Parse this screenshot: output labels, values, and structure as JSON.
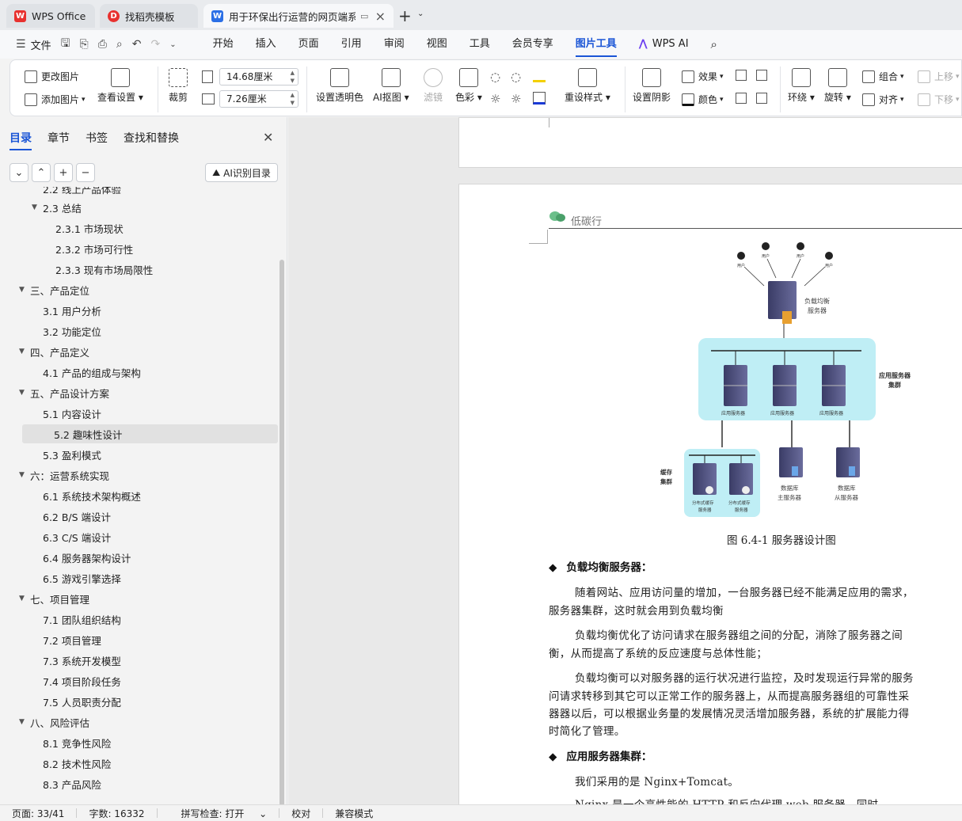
{
  "tabs": [
    {
      "label": "WPS Office",
      "icon": "wps-logo-icon"
    },
    {
      "label": "找稻壳模板",
      "icon": "docer-icon"
    },
    {
      "label": "用于环保出行运营的网页端系",
      "icon": "word-doc-icon"
    }
  ],
  "menu": {
    "file": "文件",
    "items": [
      "开始",
      "插入",
      "页面",
      "引用",
      "审阅",
      "视图",
      "工具",
      "会员专享",
      "图片工具",
      "WPS AI"
    ],
    "active": "图片工具"
  },
  "ribbon": {
    "change_image": "更改图片",
    "add_image": "添加图片",
    "view_settings": "查看设置",
    "crop": "裁剪",
    "width": "14.68厘米",
    "height": "7.26厘米",
    "set_transparent": "设置透明色",
    "ai_cutout": "AI抠图",
    "filter": "滤镜",
    "color": "色彩",
    "reset_style": "重设样式",
    "set_shadow": "设置阴影",
    "effect": "效果",
    "fill_color": "颜色",
    "wrap": "环绕",
    "rotate": "旋转",
    "group": "组合",
    "align": "对齐",
    "move_up": "上移",
    "move_down": "下移"
  },
  "sidebar": {
    "tabs": [
      "目录",
      "章节",
      "书签",
      "查找和替换"
    ],
    "active_tab": "目录",
    "ai_button": "AI识别目录",
    "toc": [
      {
        "label": "2.2  线上产品体验",
        "level": 2,
        "expand": ""
      },
      {
        "label": "2.3  总结",
        "level": 2,
        "expand": "▼"
      },
      {
        "label": "2.3.1  市场现状",
        "level": 3,
        "expand": ""
      },
      {
        "label": "2.3.2  市场可行性",
        "level": 3,
        "expand": ""
      },
      {
        "label": "2.3.3  现有市场局限性",
        "level": 3,
        "expand": ""
      },
      {
        "label": "三、产品定位",
        "level": 1,
        "expand": "▼"
      },
      {
        "label": "3.1  用户分析",
        "level": 2,
        "expand": ""
      },
      {
        "label": "3.2  功能定位",
        "level": 2,
        "expand": ""
      },
      {
        "label": "四、产品定义",
        "level": 1,
        "expand": "▼"
      },
      {
        "label": "4.1  产品的组成与架构",
        "level": 2,
        "expand": ""
      },
      {
        "label": "五、产品设计方案",
        "level": 1,
        "expand": "▼"
      },
      {
        "label": "5.1 内容设计",
        "level": 2,
        "expand": ""
      },
      {
        "label": "5.2  趣味性设计",
        "level": 2,
        "expand": "",
        "selected": true
      },
      {
        "label": "5.3  盈利模式",
        "level": 2,
        "expand": ""
      },
      {
        "label": "六：运营系统实现",
        "level": 1,
        "expand": "▼"
      },
      {
        "label": "6.1  系统技术架构概述",
        "level": 2,
        "expand": ""
      },
      {
        "label": "6.2 B/S 端设计",
        "level": 2,
        "expand": ""
      },
      {
        "label": "6.3 C/S 端设计",
        "level": 2,
        "expand": ""
      },
      {
        "label": "6.4 服务器架构设计",
        "level": 2,
        "expand": ""
      },
      {
        "label": "6.5 游戏引擎选择",
        "level": 2,
        "expand": ""
      },
      {
        "label": "七、项目管理",
        "level": 1,
        "expand": "▼"
      },
      {
        "label": "7.1  团队组织结构",
        "level": 2,
        "expand": ""
      },
      {
        "label": "7.2  项目管理",
        "level": 2,
        "expand": ""
      },
      {
        "label": "7.3  系统开发模型",
        "level": 2,
        "expand": ""
      },
      {
        "label": "7.4  项目阶段任务",
        "level": 2,
        "expand": ""
      },
      {
        "label": "7.5  人员职责分配",
        "level": 2,
        "expand": ""
      },
      {
        "label": "八、风险评估",
        "level": 1,
        "expand": "▼"
      },
      {
        "label": "8.1  竞争性风险",
        "level": 2,
        "expand": ""
      },
      {
        "label": "8.2  技术性风险",
        "level": 2,
        "expand": ""
      },
      {
        "label": "8.3  产品风险",
        "level": 2,
        "expand": ""
      }
    ]
  },
  "document": {
    "header": "低碳行",
    "diagram": {
      "user_label": "用户",
      "lb_label_1": "负载均衡",
      "lb_label_2": "服务器",
      "app_cluster_1": "应用服务器",
      "app_cluster_2": "集群",
      "app_server": "应用服务器",
      "cache_cluster_1": "缓存",
      "cache_cluster_2": "集群",
      "cache_server_1": "分布式缓存",
      "cache_server_2": "服务器",
      "db_master_1": "数据库",
      "db_master_2": "主服务器",
      "db_slave_1": "数据库",
      "db_slave_2": "从服务器"
    },
    "caption": "图 6.4-1  服务器设计图",
    "bullet1": "负载均衡服务器：",
    "p1_l1": "随着网站、应用访问量的增加，一台服务器已经不能满足应用的需求，",
    "p1_l2": "服务器集群，这时就会用到负载均衡",
    "p2_l1": "负载均衡优化了访问请求在服务器组之间的分配，消除了服务器之间",
    "p2_l2": "衡，从而提高了系统的反应速度与总体性能；",
    "p3_l1": "负载均衡可以对服务器的运行状况进行监控，及时发现运行异常的服务",
    "p3_l2": "问请求转移到其它可以正常工作的服务器上，从而提高服务器组的可靠性采",
    "p3_l3": "器器以后，可以根据业务量的发展情况灵活增加服务器，系统的扩展能力得",
    "p3_l4": "时简化了管理。",
    "bullet2": "应用服务器集群：",
    "p4_l1": "我们采用的是 Nginx+Tomcat。",
    "p5_l1": "Nginx  是一个高性能的  HTTP  和反向代理  web  服务器，同时"
  },
  "status": {
    "page": "页面: 33/41",
    "words": "字数: 16332",
    "spell": "拼写检查: 打开",
    "proof": "校对",
    "compat": "兼容模式"
  },
  "colors": {
    "accent": "#1a55d6",
    "cluster_bg": "#bfeef5",
    "server": "#4a4c78"
  }
}
